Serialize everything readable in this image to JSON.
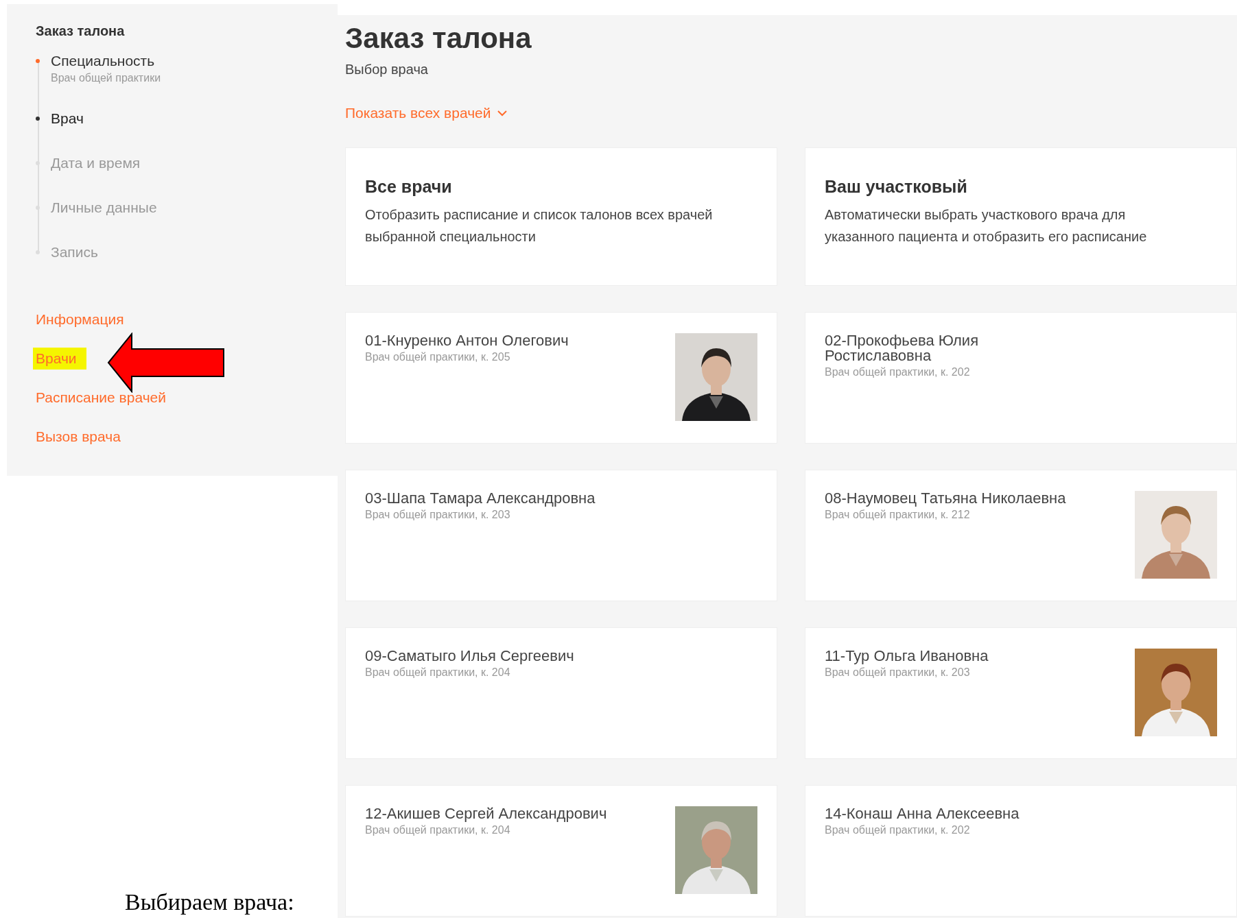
{
  "sidebar": {
    "title": "Заказ талона",
    "steps": [
      {
        "label": "Специальность",
        "detail": "Врач общей практики",
        "done": true,
        "current": false
      },
      {
        "label": "Врач",
        "done": false,
        "current": true
      },
      {
        "label": "Дата и время",
        "done": false,
        "current": false
      },
      {
        "label": "Личные данные",
        "done": false,
        "current": false
      },
      {
        "label": "Запись",
        "done": false,
        "current": false
      }
    ],
    "links": [
      {
        "label": "Информация",
        "highlighted": false,
        "pointer": false
      },
      {
        "label": "Врачи",
        "highlighted": true,
        "pointer": true
      },
      {
        "label": "Расписание врачей",
        "highlighted": false,
        "pointer": false
      },
      {
        "label": "Вызов врача",
        "highlighted": false,
        "pointer": false
      }
    ]
  },
  "page": {
    "title": "Заказ талона",
    "subtitle": "Выбор врача",
    "toggle": "Показать всех врачей"
  },
  "options": [
    {
      "title": "Все врачи",
      "description": "Отобразить расписание и список талонов всех врачей выбранной специальности"
    },
    {
      "title": "Ваш участковый",
      "description": "Автоматически выбрать участкового врача для указанного пациента и отобразить его расписание"
    }
  ],
  "doctors": [
    {
      "name": "01-Кнуренко Антон Олегович",
      "room": "Врач общей практики, к. 205"
    },
    {
      "name": "02-Прокофьева Юлия Ростиславовна",
      "room": "Врач общей практики, к. 202"
    },
    {
      "name": "03-Шапа Тамара Александровна",
      "room": "Врач общей практики, к. 203"
    },
    {
      "name": "08-Наумовец Татьяна Николаевна",
      "room": "Врач общей практики, к. 212"
    },
    {
      "name": "09-Саматыго Илья Сергеевич",
      "room": "Врач общей практики, к. 204"
    },
    {
      "name": "11-Тур Ольга Ивановна",
      "room": "Врач общей практики, к. 203"
    },
    {
      "name": "12-Акишев Сергей Александрович",
      "room": "Врач общей практики, к. 204"
    },
    {
      "name": "14-Конаш Анна Алексеевна",
      "room": "Врач общей практики, к. 202"
    }
  ],
  "caption": "Выбираем врача:"
}
